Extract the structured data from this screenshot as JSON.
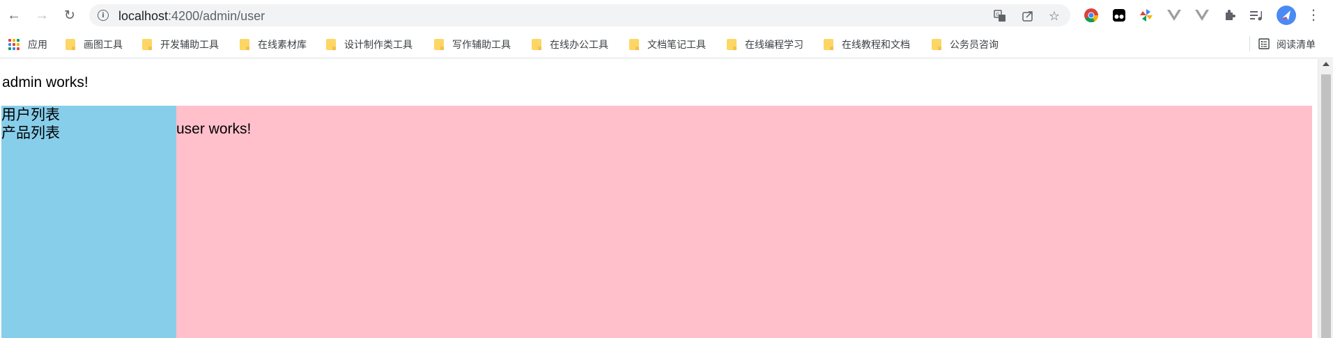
{
  "browser": {
    "url_host": "localhost",
    "url_path": ":4200/admin/user",
    "nav": {
      "back_icon": "arrow-left-icon",
      "forward_icon": "arrow-right-icon",
      "reload_icon": "reload-icon"
    },
    "omnibox_icons": [
      "site-info-icon",
      "translate-icon",
      "share-icon",
      "bookmark-star-icon"
    ],
    "extension_icons": [
      "chrome-icon",
      "tampermonkey-icon",
      "pinwheel-icon",
      "vue-devtools-icon",
      "vue-devtools-icon",
      "extensions-puzzle-icon",
      "media-controls-icon",
      "profile-avatar-icon",
      "more-menu-icon"
    ]
  },
  "bookmarks": {
    "apps_label": "应用",
    "items": [
      {
        "label": "画图工具"
      },
      {
        "label": "开发辅助工具"
      },
      {
        "label": "在线素材库"
      },
      {
        "label": "设计制作类工具"
      },
      {
        "label": "写作辅助工具"
      },
      {
        "label": "在线办公工具"
      },
      {
        "label": "文档笔记工具"
      },
      {
        "label": "在线编程学习"
      },
      {
        "label": "在线教程和文档"
      },
      {
        "label": "公务员咨询"
      }
    ],
    "reading_list_label": "阅读清单"
  },
  "page": {
    "admin_text": "admin works!",
    "sidebar": {
      "links": [
        {
          "label": "用户列表"
        },
        {
          "label": "产品列表"
        }
      ],
      "color": "#87ceeb"
    },
    "main": {
      "text": "user works!",
      "color": "#ffc0cb"
    }
  }
}
